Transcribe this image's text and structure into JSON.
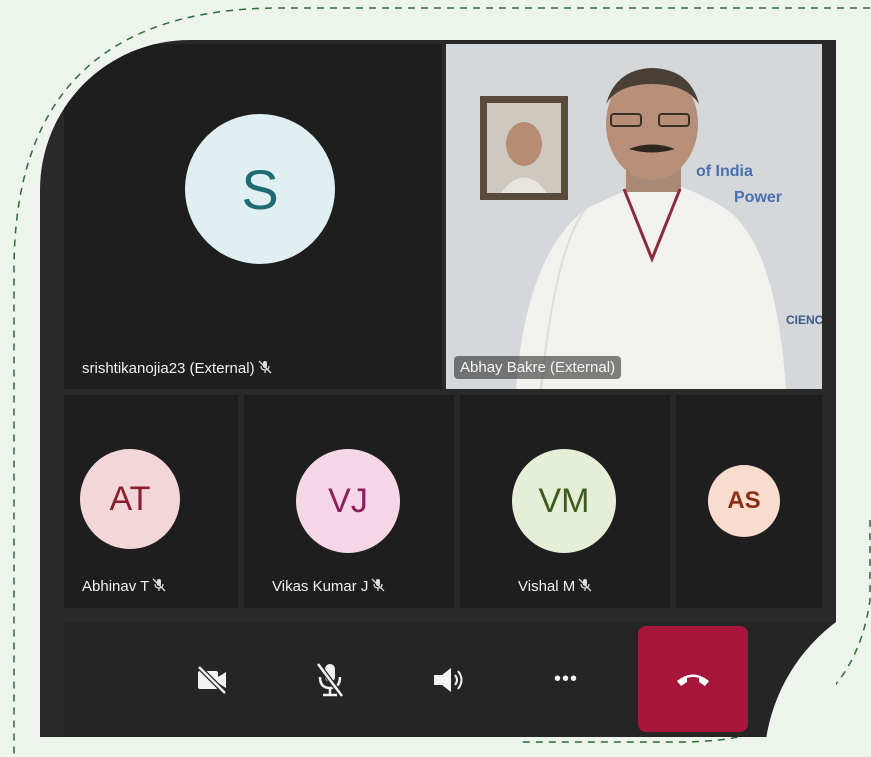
{
  "participants": {
    "featured": [
      {
        "name": "srishtikanojia23 (External)",
        "initials": "S",
        "avatar_bg": "#dfeff2",
        "avatar_fg": "#1d6b73",
        "muted": true
      },
      {
        "name": "Abhay Bakre (External)",
        "video": true,
        "muted": false
      }
    ],
    "row": [
      {
        "name": "Abhinav T",
        "initials": "AT",
        "avatar_bg": "#f3d6d8",
        "avatar_fg": "#8b1e2c",
        "muted": true
      },
      {
        "name": "Vikas Kumar J",
        "initials": "VJ",
        "avatar_bg": "#f6d7e7",
        "avatar_fg": "#8c1f5a",
        "muted": true
      },
      {
        "name": "Vishal M",
        "initials": "VM",
        "avatar_bg": "#e5efd8",
        "avatar_fg": "#3f5b21",
        "muted": true
      },
      {
        "name": "",
        "initials": "AS",
        "avatar_bg": "#f8dccd",
        "avatar_fg": "#8a2e15",
        "muted": false
      }
    ]
  },
  "video_backdrop": {
    "text_line1": "of India",
    "text_line2": "Power",
    "text_line3": "CIENC"
  },
  "controls": {
    "camera": "camera-off-icon",
    "mic": "mic-off-icon",
    "speaker": "speaker-icon",
    "more": "more-options-icon",
    "more_glyph": "•••",
    "end_call": "end-call-icon"
  },
  "colors": {
    "end_call_bg": "#a8153a",
    "page_bg": "#ecf4ec",
    "frame_bg": "#292929"
  }
}
